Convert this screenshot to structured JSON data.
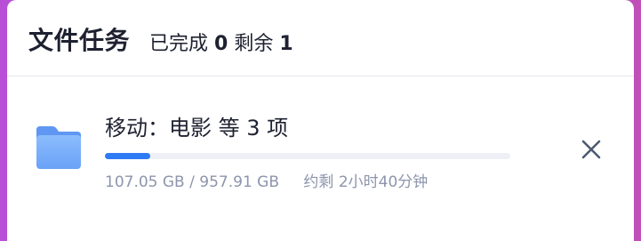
{
  "header": {
    "title": "文件任务",
    "completed_label": "已完成",
    "completed_count": "0",
    "remaining_label": "剩余",
    "remaining_count": "1"
  },
  "tasks": [
    {
      "icon": "folder-icon",
      "name": "移动：电影 等 3 项",
      "transferred": "107.05 GB",
      "separator": "/",
      "total": "957.91 GB",
      "time_remaining": "约剩 2小时40分钟",
      "progress": 0.1118,
      "close_icon": "close-icon"
    }
  ],
  "colors": {
    "accent": "#2f7bf5",
    "folder": "#79aefb",
    "text_primary": "#1e2130",
    "text_secondary": "#8d95ad",
    "track": "#eef0f5"
  }
}
